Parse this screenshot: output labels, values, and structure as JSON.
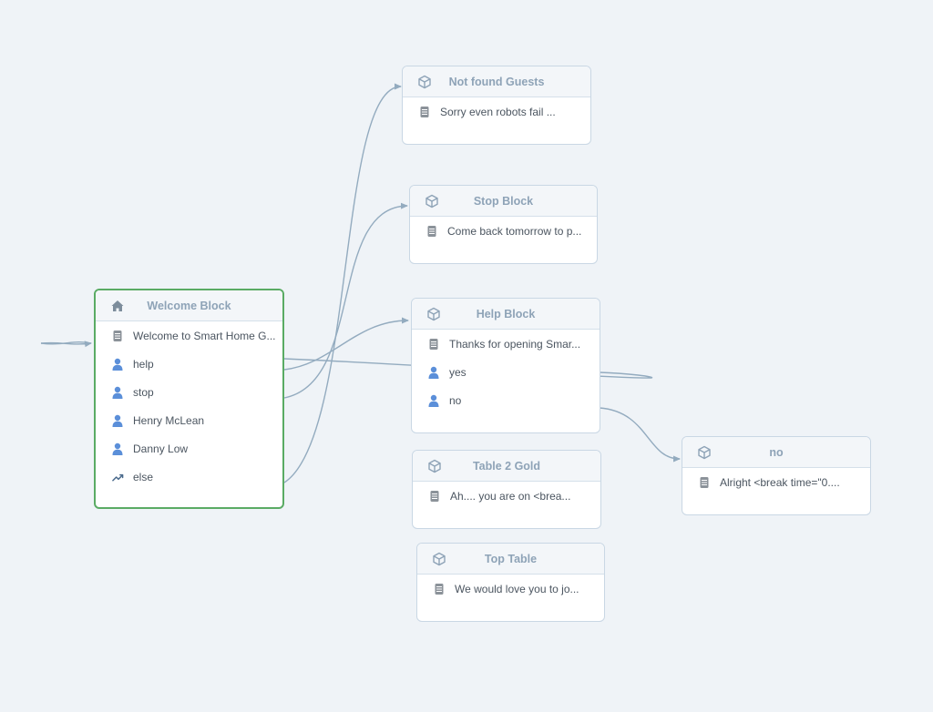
{
  "blocks": [
    {
      "id": "not-found-guests",
      "title": "Not found Guests",
      "icon": "cube-icon",
      "rows": [
        {
          "icon": "message-icon",
          "text": "Sorry even robots fail ..."
        }
      ]
    },
    {
      "id": "stop-block",
      "title": "Stop Block",
      "icon": "cube-icon",
      "rows": [
        {
          "icon": "message-icon",
          "text": "Come back tomorrow to p..."
        }
      ]
    },
    {
      "id": "welcome-block",
      "title": "Welcome Block",
      "icon": "home-icon",
      "start": true,
      "rows": [
        {
          "icon": "message-icon",
          "text": "Welcome to Smart Home G..."
        },
        {
          "icon": "user-icon",
          "text": "help"
        },
        {
          "icon": "user-icon",
          "text": "stop"
        },
        {
          "icon": "user-icon",
          "text": "Henry McLean"
        },
        {
          "icon": "user-icon",
          "text": "Danny Low"
        },
        {
          "icon": "branch-icon",
          "text": "else"
        }
      ]
    },
    {
      "id": "help-block",
      "title": "Help Block",
      "icon": "cube-icon",
      "rows": [
        {
          "icon": "message-icon",
          "text": "Thanks for opening Smar..."
        },
        {
          "icon": "user-icon",
          "text": "yes"
        },
        {
          "icon": "user-icon",
          "text": "no"
        }
      ]
    },
    {
      "id": "table-2-gold",
      "title": "Table 2 Gold",
      "icon": "cube-icon",
      "rows": [
        {
          "icon": "message-icon",
          "text": "Ah.... you are on <brea..."
        }
      ]
    },
    {
      "id": "top-table",
      "title": "Top Table",
      "icon": "cube-icon",
      "rows": [
        {
          "icon": "message-icon",
          "text": "We would love you to jo..."
        }
      ]
    },
    {
      "id": "no-block",
      "title": "no",
      "icon": "cube-icon",
      "rows": [
        {
          "icon": "message-icon",
          "text": "Alright <break time=\"0...."
        }
      ]
    }
  ],
  "colors": {
    "connector": "#93abbf",
    "start_border": "#5aab64",
    "user_icon": "#5b8fd9"
  }
}
